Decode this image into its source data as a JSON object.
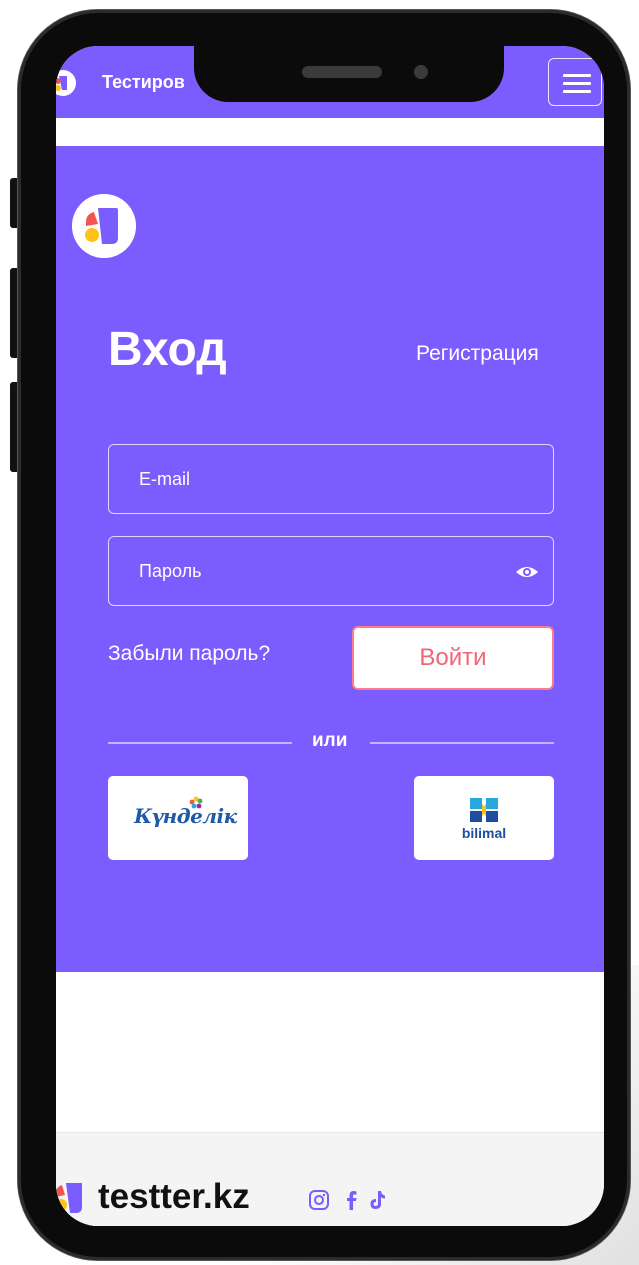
{
  "colors": {
    "primary": "#7a5cff",
    "accent": "#f06674",
    "logo_red": "#f2554d",
    "logo_yellow": "#ffc21a",
    "logo_purple": "#7a5cff",
    "social": "#7a5cff"
  },
  "topbar": {
    "title": "Тестиров",
    "logo_icon": "testter-logo-icon",
    "menu_icon": "hamburger-menu-icon"
  },
  "login": {
    "title": "Вход",
    "register_label": "Регистрация",
    "email_placeholder": "E-mail",
    "password_placeholder": "Пароль",
    "forgot_label": "Забыли пароль?",
    "submit_label": "Войти",
    "or_label": "или"
  },
  "providers": [
    {
      "name": "Күнделік",
      "icon": "kundelik-logo"
    },
    {
      "name": "bilimal",
      "icon": "bilimal-logo"
    }
  ],
  "footer": {
    "brand": "testter.kz",
    "social_icons": [
      "instagram-icon",
      "facebook-icon",
      "tiktok-icon"
    ]
  }
}
